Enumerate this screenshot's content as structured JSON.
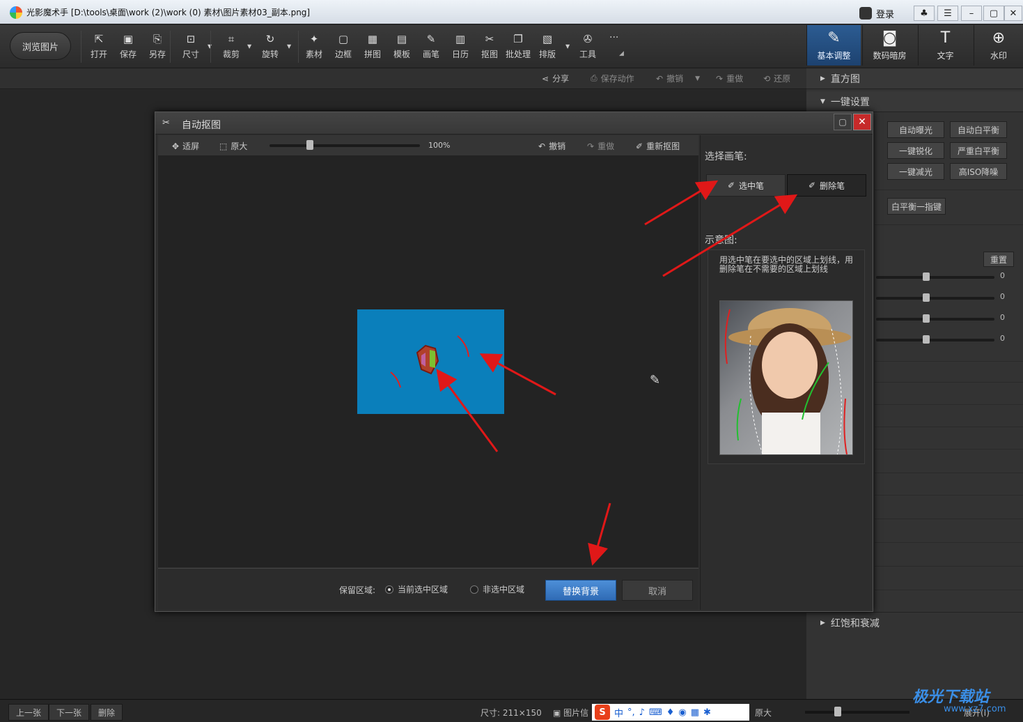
{
  "window": {
    "title": "光影魔术手  [D:\\tools\\桌面\\work (2)\\work (0) 素材\\图片素材03_副本.png]",
    "login": "登录"
  },
  "toolbar": {
    "browse": "浏览图片",
    "tools": [
      {
        "label": "打开",
        "icon": "open-icon",
        "glyph": "⇱"
      },
      {
        "label": "保存",
        "icon": "save-icon",
        "glyph": "▣"
      },
      {
        "label": "另存",
        "icon": "save-as-icon",
        "glyph": "⎘"
      },
      {
        "label": "尺寸",
        "icon": "resize-icon",
        "glyph": "⊡"
      },
      {
        "label": "裁剪",
        "icon": "crop-icon",
        "glyph": "⌗"
      },
      {
        "label": "旋转",
        "icon": "rotate-icon",
        "glyph": "↻"
      },
      {
        "label": "素材",
        "icon": "material-icon",
        "glyph": "✦"
      },
      {
        "label": "边框",
        "icon": "border-icon",
        "glyph": "▢"
      },
      {
        "label": "拼图",
        "icon": "collage-icon",
        "glyph": "▦"
      },
      {
        "label": "模板",
        "icon": "template-icon",
        "glyph": "▤"
      },
      {
        "label": "画笔",
        "icon": "brush-icon",
        "glyph": "✎"
      },
      {
        "label": "日历",
        "icon": "calendar-icon",
        "glyph": "▥"
      },
      {
        "label": "抠图",
        "icon": "cutout-icon",
        "glyph": "✂"
      },
      {
        "label": "批处理",
        "icon": "batch-icon",
        "glyph": "❐"
      },
      {
        "label": "排版",
        "icon": "layout-icon",
        "glyph": "▧"
      },
      {
        "label": "工具",
        "icon": "wrench-icon",
        "glyph": "✇"
      }
    ],
    "more": "···",
    "right_tabs": [
      {
        "label": "基本调整",
        "icon": "basic-adjust-icon",
        "glyph": "✎"
      },
      {
        "label": "数码暗房",
        "icon": "camera-icon",
        "glyph": "◙"
      },
      {
        "label": "文字",
        "icon": "text-icon",
        "glyph": "T"
      },
      {
        "label": "水印",
        "icon": "watermark-icon",
        "glyph": "⊕"
      }
    ]
  },
  "subbar": {
    "share": "分享",
    "save_action": "保存动作",
    "undo": "撤销",
    "redo": "重做",
    "restore": "还原"
  },
  "right_panel": {
    "histogram": "直方图",
    "one_click": "一键设置",
    "buttons": [
      [
        "自动曝光",
        "自动白平衡"
      ],
      [
        "一键锐化",
        "严重白平衡"
      ],
      [
        "一键减光",
        "高ISO降噪"
      ]
    ],
    "wb_button": "白平衡一指键",
    "reset": "重置",
    "sliders": [
      {
        "value": "0"
      },
      {
        "value": "0"
      },
      {
        "value": "0"
      },
      {
        "value": "0"
      }
    ],
    "red_section": "红饱和衰减"
  },
  "dialog": {
    "title": "自动抠图",
    "fit": "适屏",
    "original": "原大",
    "zoom": "100%",
    "undo": "撤销",
    "redo": "重做",
    "recut": "重新抠图",
    "choose_pen": "选择画笔:",
    "select_pen": "选中笔",
    "delete_pen": "删除笔",
    "example": "示意图:",
    "hint": "用选中笔在要选中的区域上划线，用删除笔在不需要的区域上划线",
    "keep_area": "保留区域:",
    "current_sel": "当前选中区域",
    "non_sel": "非选中区域",
    "replace_bg": "替换背景",
    "cancel": "取消"
  },
  "statusbar": {
    "prev": "上一张",
    "next": "下一张",
    "delete": "删除",
    "size": "尺寸: 211×150",
    "info": "图片信",
    "orig": "原大",
    "expand": "展开(I)"
  },
  "ime": {
    "label": "中"
  },
  "watermark": {
    "name": "极光下载站",
    "url": "www.xz7.com"
  },
  "colors": {
    "accent": "#2f6bb5",
    "arrow": "#e01818",
    "image_bg": "#0a7fbb"
  }
}
